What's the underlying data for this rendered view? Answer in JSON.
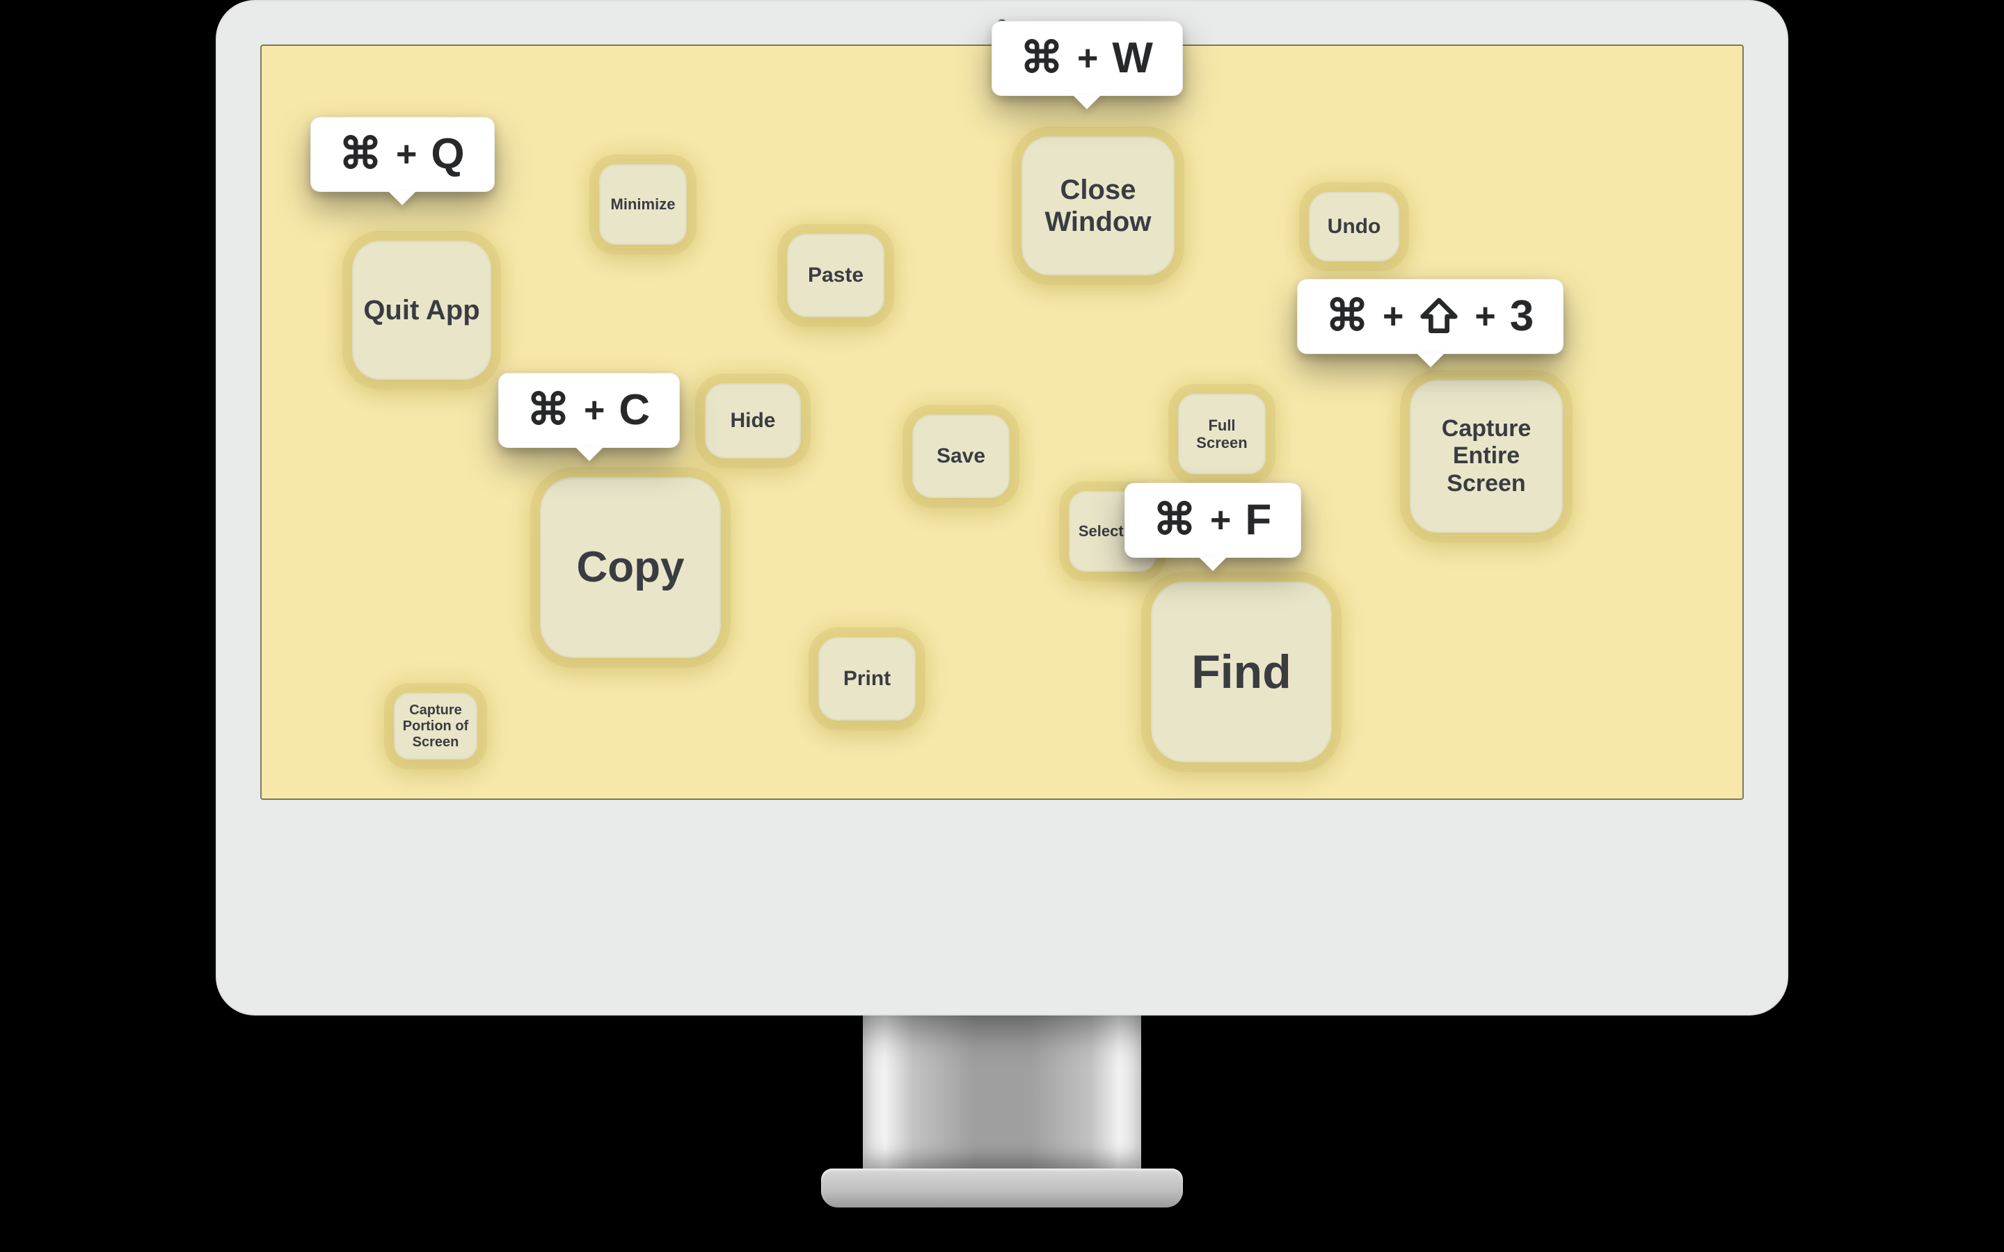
{
  "cards": {
    "quit_app": {
      "label": "Quit App"
    },
    "minimize": {
      "label": "Minimize"
    },
    "paste": {
      "label": "Paste"
    },
    "close_window": {
      "label": "Close Window"
    },
    "undo": {
      "label": "Undo"
    },
    "hide": {
      "label": "Hide"
    },
    "save": {
      "label": "Save"
    },
    "full_screen": {
      "label": "Full Screen"
    },
    "copy": {
      "label": "Copy"
    },
    "print": {
      "label": "Print"
    },
    "select_all": {
      "label": "Select All"
    },
    "find": {
      "label": "Find"
    },
    "capture_entire_screen": {
      "label": "Capture Entire Screen"
    },
    "capture_portion_screen": {
      "label": "Capture Portion of Screen"
    }
  },
  "shortcuts": {
    "quit_app": {
      "keys": [
        "⌘",
        "+",
        "Q"
      ]
    },
    "close_window": {
      "keys": [
        "⌘",
        "+",
        "W"
      ]
    },
    "copy": {
      "keys": [
        "⌘",
        "+",
        "C"
      ]
    },
    "find": {
      "keys": [
        "⌘",
        "+",
        "F"
      ]
    },
    "capture_entire_screen": {
      "keys": [
        "⌘",
        "+",
        "SHIFT",
        "+",
        "3"
      ]
    }
  }
}
